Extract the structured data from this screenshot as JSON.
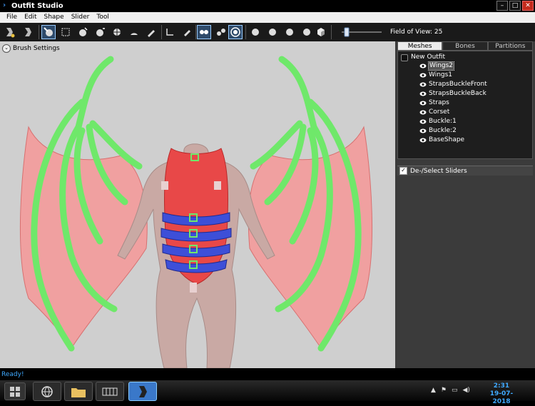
{
  "window": {
    "title": "Outfit Studio",
    "app_icon": "chevron-right-icon"
  },
  "menu": [
    "File",
    "Edit",
    "Shape",
    "Slider",
    "Tool"
  ],
  "toolbar": {
    "fov_label": "Field of View: 25",
    "fov_value": 25
  },
  "viewport": {
    "brush_settings_label": "Brush Settings"
  },
  "panel": {
    "tabs": [
      "Meshes",
      "Bones",
      "Partitions"
    ],
    "selected_tab": "Meshes",
    "root": "New Outfit",
    "meshes": [
      "Wings2",
      "Wings1",
      "StrapsBuckleFront",
      "StrapsBuckleBack",
      "Straps",
      "Corset",
      "Buckle:1",
      "Buckle:2",
      "BaseShape"
    ],
    "selected_mesh": "Wings2",
    "sliders_label": "De-/Select Sliders"
  },
  "status": {
    "text": "Ready!"
  },
  "taskbar": {
    "time": "2:31",
    "date": "19-07-2018"
  },
  "colors": {
    "accent": "#3fa9ff",
    "mesh_green": "#6fe86a",
    "mesh_red": "#e84848",
    "mesh_blue": "#3d4fd8",
    "viewport_bg": "#cfcfcf"
  }
}
